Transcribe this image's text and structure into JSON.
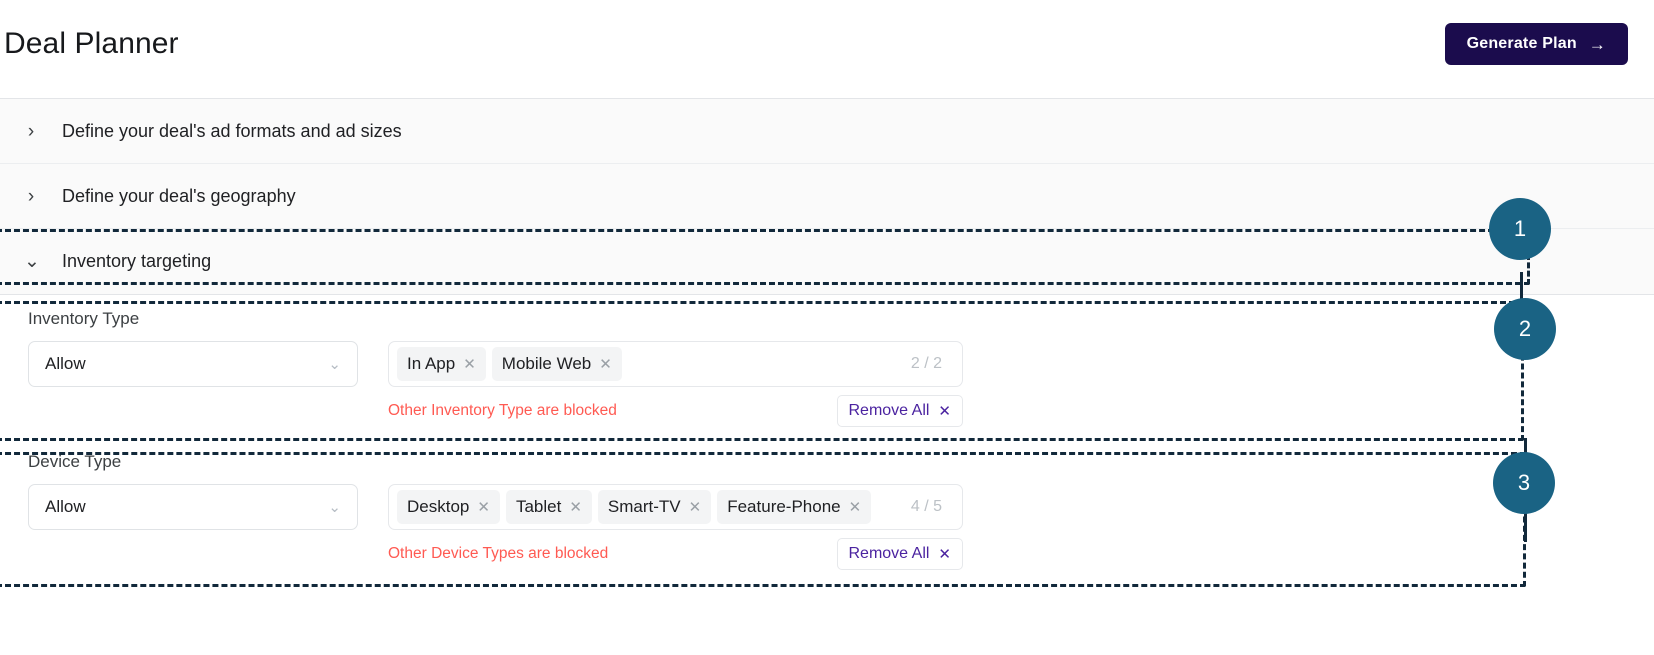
{
  "header": {
    "title": "Deal Planner",
    "generate_button": {
      "label": "Generate Plan",
      "arrow_icon": "→"
    }
  },
  "accordion": {
    "rows": [
      {
        "label": "Define your deal's ad formats and ad sizes",
        "chevron": "›",
        "expanded": false
      },
      {
        "label": "Define your deal's geography",
        "chevron": "›",
        "expanded": false
      },
      {
        "label": "Inventory targeting",
        "chevron": "⌄",
        "expanded": true
      }
    ]
  },
  "targeting": {
    "fields": [
      {
        "label": "Inventory Type",
        "select": {
          "value": "Allow",
          "chevron": "⌄"
        },
        "chips": [
          {
            "label": "In App",
            "remove_icon": "✕"
          },
          {
            "label": "Mobile Web",
            "remove_icon": "✕"
          }
        ],
        "count": "2 / 2",
        "blocked_message": "Other Inventory Type are blocked",
        "remove_all": {
          "label": "Remove All",
          "icon": "✕"
        }
      },
      {
        "label": "Device Type",
        "select": {
          "value": "Allow",
          "chevron": "⌄"
        },
        "chips": [
          {
            "label": "Desktop",
            "remove_icon": "✕"
          },
          {
            "label": "Tablet",
            "remove_icon": "✕"
          },
          {
            "label": "Smart-TV",
            "remove_icon": "✕"
          },
          {
            "label": "Feature-Phone",
            "remove_icon": "✕"
          }
        ],
        "count": "4 / 5",
        "blocked_message": "Other Device Types are blocked",
        "remove_all": {
          "label": "Remove All",
          "icon": "✕"
        }
      }
    ]
  },
  "annotations": {
    "badges": [
      {
        "number": "1"
      },
      {
        "number": "2"
      },
      {
        "number": "3"
      }
    ],
    "colors": {
      "badge_fill": "#1a6384",
      "dash_stroke": "#12293b",
      "accent_button": "#1b0c4d",
      "blocked_text": "#ff5a52",
      "remove_all_text": "#4b23a0"
    }
  }
}
